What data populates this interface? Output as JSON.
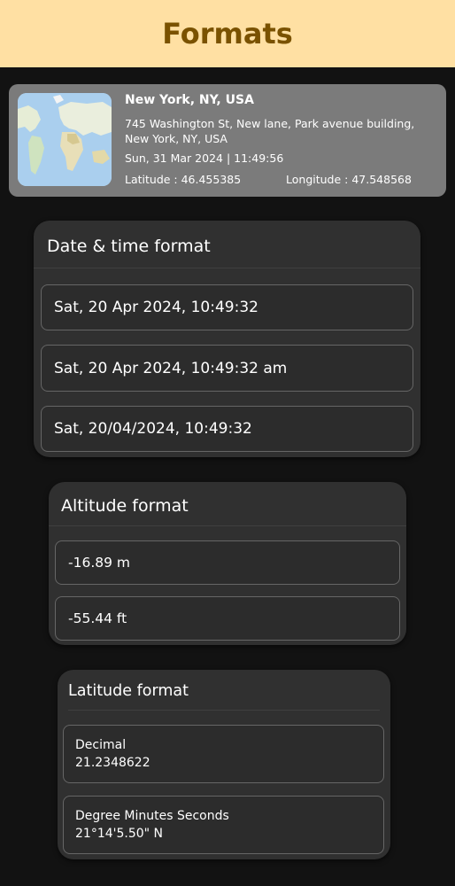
{
  "header": {
    "title": "Formats"
  },
  "location_card": {
    "city": "New York, NY, USA",
    "address": "745 Washington St, New lane, Park avenue building, New York, NY, USA",
    "datetime": "Sun, 31 Mar 2024 | 11:49:56",
    "latitude": "Latitude : 46.455385",
    "longitude": "Longitude : 47.548568"
  },
  "date_time_format": {
    "title": "Date & time format",
    "options": [
      "Sat, 20 Apr 2024, 10:49:32",
      "Sat, 20 Apr 2024, 10:49:32 am",
      "Sat, 20/04/2024, 10:49:32"
    ]
  },
  "altitude_format": {
    "title": "Altitude format",
    "options": [
      "-16.89 m",
      "-55.44 ft"
    ]
  },
  "latitude_format": {
    "title": "Latitude format",
    "options": [
      {
        "label": "Decimal",
        "value": "21.2348622"
      },
      {
        "label": "Degree Minutes Seconds",
        "value": "21°14'5.50\" N"
      }
    ]
  },
  "colors": {
    "header_bg": "#ffe0a3",
    "header_text": "#7a5200",
    "background": "#121212",
    "panel_bg": "#303030",
    "card_bg": "#7b7b7b"
  }
}
